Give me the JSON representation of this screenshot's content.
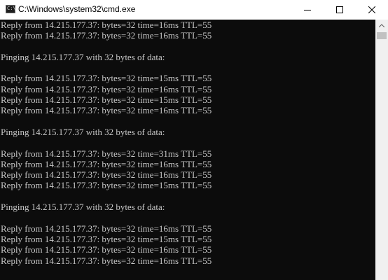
{
  "window": {
    "title": "C:\\Windows\\system32\\cmd.exe",
    "app_icon_glyph": "C:\\",
    "controls": {
      "minimize": "minimize-icon",
      "maximize": "maximize-icon",
      "close": "close-icon"
    }
  },
  "console": {
    "background_color": "#0c0c0c",
    "text_color": "#c8c8c8",
    "lines": [
      "Reply from 14.215.177.37: bytes=32 time=16ms TTL=55",
      "Reply from 14.215.177.37: bytes=32 time=16ms TTL=55",
      "",
      "Pinging 14.215.177.37 with 32 bytes of data:",
      "",
      "Reply from 14.215.177.37: bytes=32 time=15ms TTL=55",
      "Reply from 14.215.177.37: bytes=32 time=16ms TTL=55",
      "Reply from 14.215.177.37: bytes=32 time=15ms TTL=55",
      "Reply from 14.215.177.37: bytes=32 time=16ms TTL=55",
      "",
      "Pinging 14.215.177.37 with 32 bytes of data:",
      "",
      "Reply from 14.215.177.37: bytes=32 time=31ms TTL=55",
      "Reply from 14.215.177.37: bytes=32 time=16ms TTL=55",
      "Reply from 14.215.177.37: bytes=32 time=16ms TTL=55",
      "Reply from 14.215.177.37: bytes=32 time=15ms TTL=55",
      "",
      "Pinging 14.215.177.37 with 32 bytes of data:",
      "",
      "Reply from 14.215.177.37: bytes=32 time=16ms TTL=55",
      "Reply from 14.215.177.37: bytes=32 time=15ms TTL=55",
      "Reply from 14.215.177.37: bytes=32 time=16ms TTL=55",
      "Reply from 14.215.177.37: bytes=32 time=16ms TTL=55"
    ]
  }
}
